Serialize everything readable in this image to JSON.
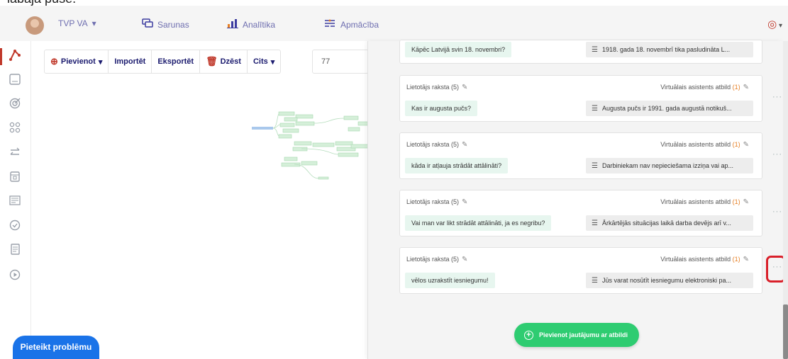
{
  "caption": "labajā pusē.",
  "topnav": {
    "account": "TVP VA",
    "items": [
      {
        "icon": "chat-icon",
        "label": "Sarunas"
      },
      {
        "icon": "chart-icon",
        "label": "Analītika"
      },
      {
        "icon": "training-icon",
        "label": "Apmācība"
      }
    ]
  },
  "sidebar": {
    "icons": [
      "flow-icon",
      "layout-icon",
      "target-icon",
      "grid-icon",
      "swap-icon",
      "calendar-icon",
      "form-icon",
      "check-icon",
      "document-icon",
      "play-icon"
    ]
  },
  "toolbar": {
    "add_label": "Pievienot",
    "import_label": "Importēt",
    "export_label": "Eksportēt",
    "delete_label": "Dzēst",
    "other_label": "Cits",
    "search_value": "77"
  },
  "panel": {
    "user_label": "Lietotājs raksta",
    "user_count": "(5)",
    "va_label": "Virtuālais asistents atbild",
    "va_count": "(1)",
    "cards": [
      {
        "question": "Kāpēc Latvijā svin 18. novembri?",
        "answer": "1918. gada 18. novembrī tika pasludināta L..."
      },
      {
        "question": "Kas ir augusta pučs?",
        "answer": "Augusta pučs ir 1991. gada augustā notikuš..."
      },
      {
        "question": "kāda ir atļauja strādāt attālināti?",
        "answer": "Darbiniekam nav nepieciešama izziņa vai ap..."
      },
      {
        "question": "Vai man var likt strādāt attālināti, ja es negribu?",
        "answer": "Ārkārtējās situācijas laikā darba devējs arī v..."
      },
      {
        "question": "vēlos uzrakstīt iesniegumu!",
        "answer": "Jūs varat nosūtīt iesniegumu elektroniski pa..."
      }
    ],
    "add_button": "Pievienot jautājumu ar atbildi"
  },
  "report_button": "Pieteikt problēmu",
  "colors": {
    "accent_red": "#c0392b",
    "green": "#2ecc71",
    "blue": "#1a73e8",
    "nav_blue": "#3c3ca0"
  }
}
